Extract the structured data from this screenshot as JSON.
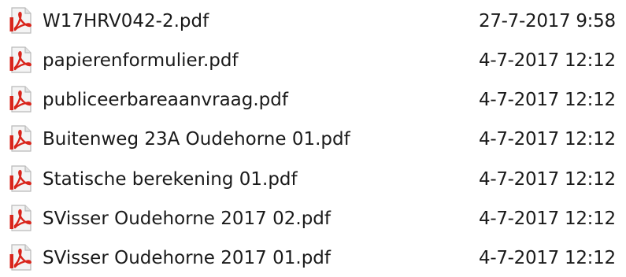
{
  "files": [
    {
      "name": "W17HRV042-2.pdf",
      "modified": "27-7-2017 9:58",
      "icon": "pdf-file-icon"
    },
    {
      "name": "papierenformulier.pdf",
      "modified": "4-7-2017 12:12",
      "icon": "pdf-file-icon"
    },
    {
      "name": "publiceerbareaanvraag.pdf",
      "modified": "4-7-2017 12:12",
      "icon": "pdf-file-icon"
    },
    {
      "name": "Buitenweg 23A Oudehorne 01.pdf",
      "modified": "4-7-2017 12:12",
      "icon": "pdf-file-icon"
    },
    {
      "name": "Statische berekening 01.pdf",
      "modified": "4-7-2017 12:12",
      "icon": "pdf-file-icon"
    },
    {
      "name": "SVisser Oudehorne 2017 02.pdf",
      "modified": "4-7-2017 12:12",
      "icon": "pdf-file-icon"
    },
    {
      "name": "SVisser Oudehorne 2017 01.pdf",
      "modified": "4-7-2017 12:12",
      "icon": "pdf-file-icon"
    }
  ],
  "colors": {
    "pdf_red": "#d9251c",
    "page_fill": "#f4f4f4",
    "page_border": "#b9b9b9"
  }
}
